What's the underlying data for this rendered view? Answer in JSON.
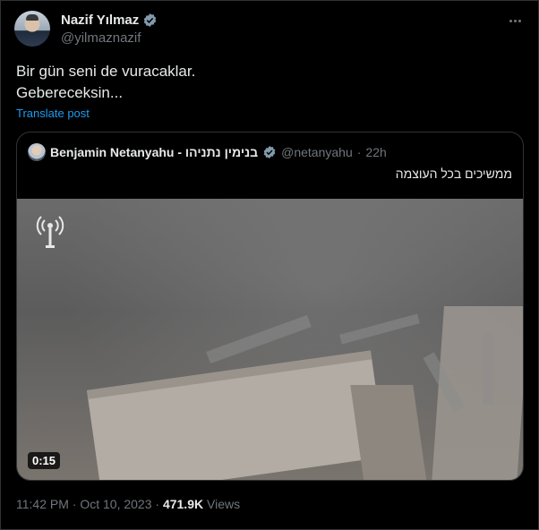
{
  "author": {
    "name": "Nazif Yılmaz",
    "handle": "@yilmaznazif"
  },
  "post": {
    "lines": [
      "Bir gün seni de vuracaklar.",
      "Gebereceksin..."
    ],
    "translate": "Translate post"
  },
  "quote": {
    "name": "Benjamin Netanyahu - בנימין נתניהו",
    "handle": "@netanyahu",
    "time": "22h",
    "text": "ממשיכים בכל העוצמה",
    "video_duration": "0:15"
  },
  "meta": {
    "datetime": "11:42 PM · Oct 10, 2023",
    "views_count": "471.9K",
    "views_label": "Views"
  },
  "colors": {
    "background": "#000000",
    "text": "#e7e9ea",
    "muted": "#71767b",
    "link": "#1d9bf0",
    "verified": "#829aab",
    "border": "#2f3336"
  },
  "icons": [
    "verified-badge-icon",
    "more-options-icon",
    "idf-logo-icon"
  ]
}
